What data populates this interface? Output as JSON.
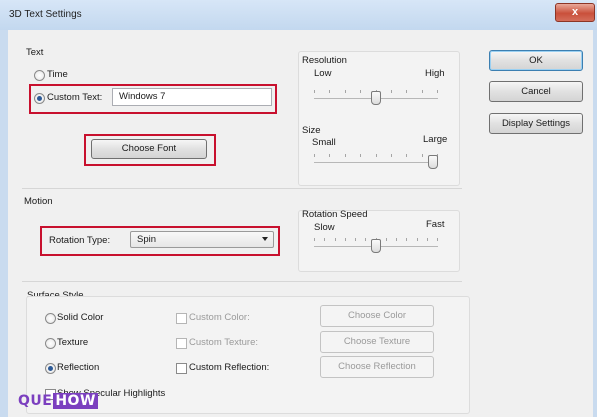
{
  "window": {
    "title": "3D Text Settings",
    "close_label": "x"
  },
  "text_group": {
    "label": "Text",
    "time_label": "Time",
    "custom_text_label": "Custom Text:",
    "custom_text_value": "Windows 7",
    "selected": "custom_text",
    "choose_font_label": "Choose Font"
  },
  "resolution": {
    "label": "Resolution",
    "min_label": "Low",
    "max_label": "High",
    "value_fraction": 0.5
  },
  "size": {
    "label": "Size",
    "min_label": "Small",
    "max_label": "Large",
    "value_fraction": 1.0
  },
  "motion_group": {
    "label": "Motion",
    "rotation_type_label": "Rotation Type:",
    "rotation_type_value": "Spin"
  },
  "rotation_speed": {
    "label": "Rotation Speed",
    "min_label": "Slow",
    "max_label": "Fast",
    "value_fraction": 0.5
  },
  "surface_style": {
    "label": "Surface Style",
    "selected": "reflection",
    "solid_color_label": "Solid Color",
    "texture_label": "Texture",
    "reflection_label": "Reflection",
    "custom_color_label": "Custom Color:",
    "custom_texture_label": "Custom Texture:",
    "custom_reflection_label": "Custom Reflection:",
    "choose_color_label": "Choose Color",
    "choose_texture_label": "Choose Texture",
    "choose_reflection_label": "Choose Reflection",
    "show_specular_label": "Show Specular Highlights"
  },
  "buttons": {
    "ok": "OK",
    "cancel": "Cancel",
    "display_settings": "Display Settings"
  },
  "watermark": {
    "left": "QUE",
    "right": "HOW"
  },
  "colors": {
    "highlight": "#c8102e",
    "accent": "#2d5a97"
  }
}
